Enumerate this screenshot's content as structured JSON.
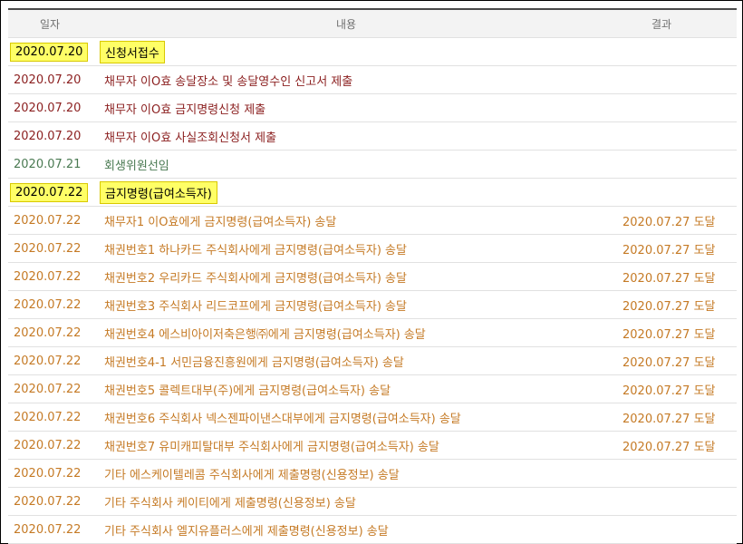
{
  "colors": {
    "maroon": "#8b1f1f",
    "green": "#4a7a52",
    "orange": "#c57a25",
    "highlight": "#ffff66"
  },
  "table": {
    "headers": {
      "date": "일자",
      "content": "내용",
      "result": "결과"
    },
    "rows": [
      {
        "date": "2020.07.20",
        "content": "신청서접수",
        "result": "",
        "color": "#8b1f1f",
        "highlight": true
      },
      {
        "date": "2020.07.20",
        "content": "채무자 이O효 송달장소 및 송달영수인 신고서 제출",
        "result": "",
        "color": "#8b1f1f",
        "highlight": false
      },
      {
        "date": "2020.07.20",
        "content": "채무자 이O효 금지명령신청 제출",
        "result": "",
        "color": "#8b1f1f",
        "highlight": false
      },
      {
        "date": "2020.07.20",
        "content": "채무자 이O효 사실조회신청서 제출",
        "result": "",
        "color": "#8b1f1f",
        "highlight": false
      },
      {
        "date": "2020.07.21",
        "content": "회생위원선임",
        "result": "",
        "color": "#4a7a52",
        "highlight": false
      },
      {
        "date": "2020.07.22",
        "content": "금지명령(급여소득자)",
        "result": "",
        "color": "#4a7a52",
        "highlight": true
      },
      {
        "date": "2020.07.22",
        "content": "채무자1 이O효에게 금지명령(급여소득자) 송달",
        "result": "2020.07.27 도달",
        "color": "#c57a25",
        "highlight": false
      },
      {
        "date": "2020.07.22",
        "content": "채권번호1 하나카드 주식회사에게 금지명령(급여소득자) 송달",
        "result": "2020.07.27 도달",
        "color": "#c57a25",
        "highlight": false
      },
      {
        "date": "2020.07.22",
        "content": "채권번호2 우리카드 주식회사에게 금지명령(급여소득자) 송달",
        "result": "2020.07.27 도달",
        "color": "#c57a25",
        "highlight": false
      },
      {
        "date": "2020.07.22",
        "content": "채권번호3 주식회사 리드코프에게 금지명령(급여소득자) 송달",
        "result": "2020.07.27 도달",
        "color": "#c57a25",
        "highlight": false
      },
      {
        "date": "2020.07.22",
        "content": "채권번호4 에스비아이저축은행㈜에게 금지명령(급여소득자) 송달",
        "result": "2020.07.27 도달",
        "color": "#c57a25",
        "highlight": false
      },
      {
        "date": "2020.07.22",
        "content": "채권번호4-1 서민금융진흥원에게 금지명령(급여소득자) 송달",
        "result": "2020.07.27 도달",
        "color": "#c57a25",
        "highlight": false
      },
      {
        "date": "2020.07.22",
        "content": "채권번호5 콜렉트대부(주)에게 금지명령(급여소득자) 송달",
        "result": "2020.07.27 도달",
        "color": "#c57a25",
        "highlight": false
      },
      {
        "date": "2020.07.22",
        "content": "채권번호6 주식회사 넥스젠파이낸스대부에게 금지명령(급여소득자) 송달",
        "result": "2020.07.27 도달",
        "color": "#c57a25",
        "highlight": false
      },
      {
        "date": "2020.07.22",
        "content": "채권번호7 유미캐피탈대부 주식회사에게 금지명령(급여소득자) 송달",
        "result": "2020.07.27 도달",
        "color": "#c57a25",
        "highlight": false
      },
      {
        "date": "2020.07.22",
        "content": "기타 에스케이텔레콤 주식회사에게 제출명령(신용정보) 송달",
        "result": "",
        "color": "#c57a25",
        "highlight": false
      },
      {
        "date": "2020.07.22",
        "content": "기타 주식회사 케이티에게 제출명령(신용정보) 송달",
        "result": "",
        "color": "#c57a25",
        "highlight": false
      },
      {
        "date": "2020.07.22",
        "content": "기타 주식회사 엘지유플러스에게 제출명령(신용정보) 송달",
        "result": "",
        "color": "#c57a25",
        "highlight": false
      }
    ]
  }
}
